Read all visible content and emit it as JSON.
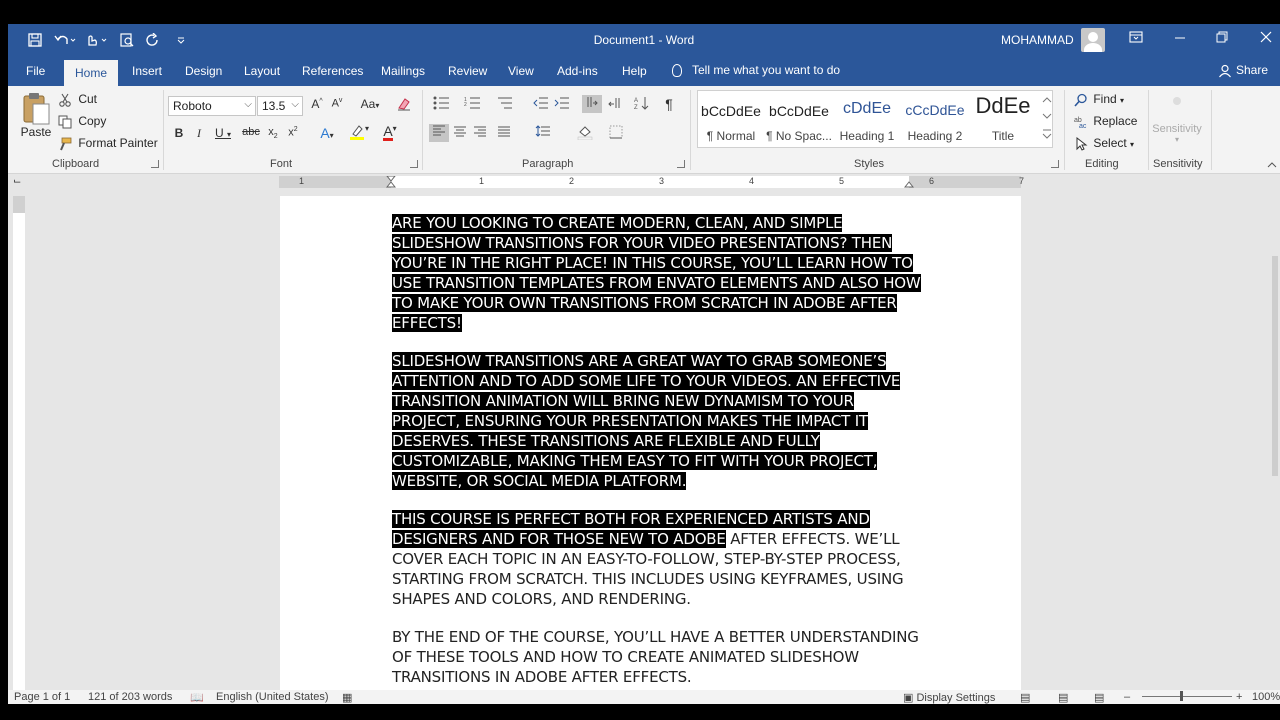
{
  "window": {
    "title": "Document1 - Word",
    "user": "MOHAMMAD"
  },
  "tabs": {
    "file": "File",
    "home": "Home",
    "insert": "Insert",
    "design": "Design",
    "layout": "Layout",
    "references": "References",
    "mailings": "Mailings",
    "review": "Review",
    "view": "View",
    "addins": "Add-ins",
    "help": "Help",
    "tell_me": "Tell me what you want to do",
    "share": "Share"
  },
  "ribbon": {
    "clipboard": {
      "label": "Clipboard",
      "paste": "Paste",
      "cut": "Cut",
      "copy": "Copy",
      "format_painter": "Format Painter"
    },
    "font": {
      "label": "Font",
      "family": "Roboto",
      "size": "13.5"
    },
    "paragraph": {
      "label": "Paragraph"
    },
    "styles": {
      "label": "Styles",
      "items": [
        {
          "preview": "bCcDdEe",
          "name": "¶ Normal"
        },
        {
          "preview": "bCcDdEe",
          "name": "¶ No Spac..."
        },
        {
          "preview": "cDdEe",
          "name": "Heading 1"
        },
        {
          "preview": "cCcDdEe",
          "name": "Heading 2"
        },
        {
          "preview": "DdEe",
          "name": "Title"
        }
      ]
    },
    "editing": {
      "label": "Editing",
      "find": "Find",
      "replace": "Replace",
      "select": "Select"
    },
    "sensitivity": {
      "label": "Sensitivity",
      "button": "Sensitivity"
    }
  },
  "ruler": {
    "numbers": [
      "1",
      "1",
      "2",
      "3",
      "4",
      "5",
      "6",
      "7"
    ]
  },
  "document": {
    "p1": "ARE YOU LOOKING TO CREATE MODERN, CLEAN, AND SIMPLE SLIDESHOW TRANSITIONS FOR YOUR VIDEO PRESENTATIONS? THEN YOU’RE IN THE RIGHT PLACE! IN THIS COURSE, YOU’LL LEARN HOW TO USE TRANSITION TEMPLATES FROM ENVATO ELEMENTS AND ALSO HOW TO MAKE YOUR OWN TRANSITIONS FROM SCRATCH IN ADOBE AFTER EFFECTS!",
    "p2": "SLIDESHOW TRANSITIONS ARE A GREAT WAY TO GRAB SOMEONE’S ATTENTION AND TO ADD SOME LIFE TO YOUR VIDEOS. AN EFFECTIVE TRANSITION ANIMATION WILL BRING NEW DYNAMISM TO YOUR PROJECT, ENSURING YOUR PRESENTATION MAKES THE IMPACT IT DESERVES. THESE TRANSITIONS ARE FLEXIBLE AND FULLY CUSTOMIZABLE, MAKING THEM EASY TO FIT WITH YOUR PROJECT, WEBSITE, OR SOCIAL MEDIA PLATFORM.",
    "p3_selected": "THIS COURSE IS PERFECT BOTH FOR EXPERIENCED ARTISTS AND DESIGNERS AND FOR THOSE NEW TO ADOBE",
    "p3_rest": " AFTER EFFECTS. WE’LL COVER EACH TOPIC IN AN EASY-TO-FOLLOW, STEP-BY-STEP PROCESS, STARTING FROM SCRATCH. THIS INCLUDES USING KEYFRAMES, USING SHAPES AND COLORS, AND RENDERING.",
    "p4": "BY THE END OF THE COURSE, YOU’LL HAVE A BETTER UNDERSTANDING OF THESE TOOLS AND HOW TO CREATE ANIMATED SLIDESHOW TRANSITIONS IN ADOBE AFTER EFFECTS."
  },
  "status": {
    "page": "Page 1 of 1",
    "words": "121 of 203 words",
    "language": "English (United States)",
    "display_settings": "Display Settings",
    "zoom": "100%"
  }
}
